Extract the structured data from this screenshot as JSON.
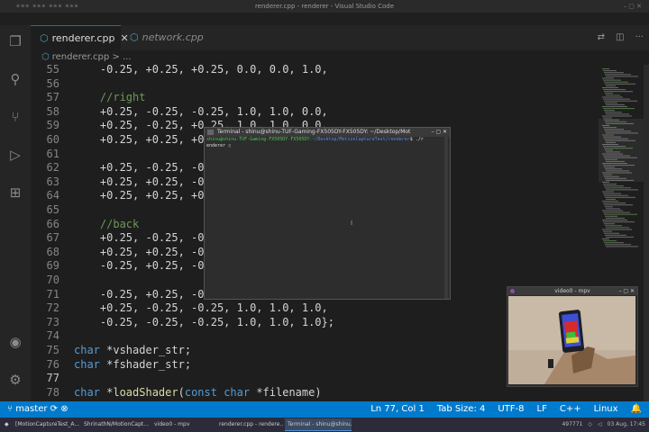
{
  "window": {
    "title": "renderer.cpp - renderer - Visual Studio Code"
  },
  "tabs": [
    {
      "label": "renderer.cpp",
      "active": true
    },
    {
      "label": "network.cpp",
      "active": false
    }
  ],
  "breadcrumb": {
    "file": "renderer.cpp",
    "separator": ">",
    "rest": "..."
  },
  "code_lines": [
    {
      "num": "55",
      "text": "    -0.25, +0.25, +0.25, 0.0, 0.0, 1.0,"
    },
    {
      "num": "56",
      "text": ""
    },
    {
      "num": "57",
      "text": "    //right"
    },
    {
      "num": "58",
      "text": "    +0.25, -0.25, -0.25, 1.0, 1.0, 0.0,"
    },
    {
      "num": "59",
      "text": "    +0.25, -0.25, +0.25, 1.0, 1.0, 0.0,"
    },
    {
      "num": "60",
      "text": "    +0.25, +0.25, +0.25,"
    },
    {
      "num": "61",
      "text": ""
    },
    {
      "num": "62",
      "text": "    +0.25, -0.25, -0.25,"
    },
    {
      "num": "63",
      "text": "    +0.25, +0.25, -0.25,"
    },
    {
      "num": "64",
      "text": "    +0.25, +0.25, +0.25,"
    },
    {
      "num": "65",
      "text": ""
    },
    {
      "num": "66",
      "text": "    //back"
    },
    {
      "num": "67",
      "text": "    +0.25, -0.25, -0.25,"
    },
    {
      "num": "68",
      "text": "    +0.25, +0.25, -0.25,"
    },
    {
      "num": "69",
      "text": "    -0.25, +0.25, -0.25,"
    },
    {
      "num": "70",
      "text": ""
    },
    {
      "num": "71",
      "text": "    -0.25, +0.25, -0.25,"
    },
    {
      "num": "72",
      "text": "    +0.25, -0.25, -0.25, 1.0, 1.0, 1.0,"
    },
    {
      "num": "73",
      "text": "    -0.25, -0.25, -0.25, 1.0, 1.0, 1.0};"
    },
    {
      "num": "74",
      "text": ""
    },
    {
      "num": "75",
      "text": "char *vshader_str;"
    },
    {
      "num": "76",
      "text": "char *fshader_str;"
    },
    {
      "num": "77",
      "text": ""
    },
    {
      "num": "78",
      "text": "char *loadShader(const char *filename)"
    }
  ],
  "terminal": {
    "title": "Terminal - shinu@shinu-TUF-Gaming-FX505DY-FX505DY: ~/Desktop/Mot",
    "prompt_user": "shinu@shinu-TUF-Gaming-FX505DY-FX505DY",
    "prompt_path": ":~/Desktop/MotionCaptureTest/renderer",
    "prompt_symbol": "$",
    "command": "./r",
    "command_wrap": "enderer"
  },
  "mpv": {
    "title": "video0 - mpv"
  },
  "status": {
    "branch": "master",
    "position": "Ln 77, Col 1",
    "tab_size": "Tab Size: 4",
    "encoding": "UTF-8",
    "eol": "LF",
    "language": "C++",
    "platform": "Linux"
  },
  "taskbar": {
    "items": [
      "[MotionCaptureTest_A...",
      "ShrinathN/MotionCapt...",
      "video0 - mpv",
      "renderer.cpp - rendere...",
      "Terminal - shinu@shinu..."
    ],
    "tray_value": "497771",
    "datetime": "03 Aug, 17:45"
  },
  "colors": {
    "accent": "#007acc",
    "keyword": "#569cd6",
    "function": "#dcdcaa",
    "comment": "#6a9955"
  }
}
